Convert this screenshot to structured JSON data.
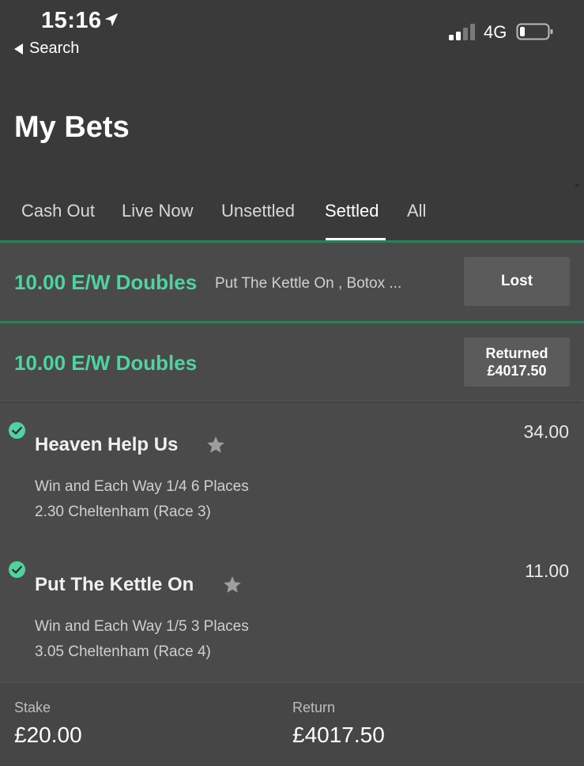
{
  "status_bar": {
    "time": "15:16",
    "back_label": "Search",
    "network": "4G",
    "icons": [
      "location-arrow-icon",
      "signal-icon",
      "battery-icon"
    ]
  },
  "page": {
    "title": "My Bets"
  },
  "tabs": [
    {
      "label": "Cash Out"
    },
    {
      "label": "Live Now"
    },
    {
      "label": "Unsettled"
    },
    {
      "label": "Settled"
    },
    {
      "label": "All"
    }
  ],
  "active_tab": "Settled",
  "bets": [
    {
      "title": "10.00 E/W Doubles",
      "description": "Put The Kettle On , Botox ...",
      "status": "Lost"
    },
    {
      "title": "10.00 E/W Doubles",
      "status_line1": "Returned",
      "status_line2": "£4017.50"
    }
  ],
  "selections": [
    {
      "name": "Heaven Help Us",
      "odds": "34.00",
      "line1": "Win and Each Way 1/4 6 Places",
      "line2": "2.30 Cheltenham (Race 3)"
    },
    {
      "name": "Put The Kettle On",
      "odds": "11.00",
      "line1": "Win and Each Way 1/5 3 Places",
      "line2": "3.05 Cheltenham (Race 4)"
    }
  ],
  "footer": {
    "stake_label": "Stake",
    "stake_value": "£20.00",
    "return_label": "Return",
    "return_value": "£4017.50"
  },
  "colors": {
    "background": "#3a3a3a",
    "card": "#4a4a4a",
    "accent_green": "#4fd3a0",
    "divider_green": "#2e7d5b",
    "pill": "#5b5b5b"
  }
}
